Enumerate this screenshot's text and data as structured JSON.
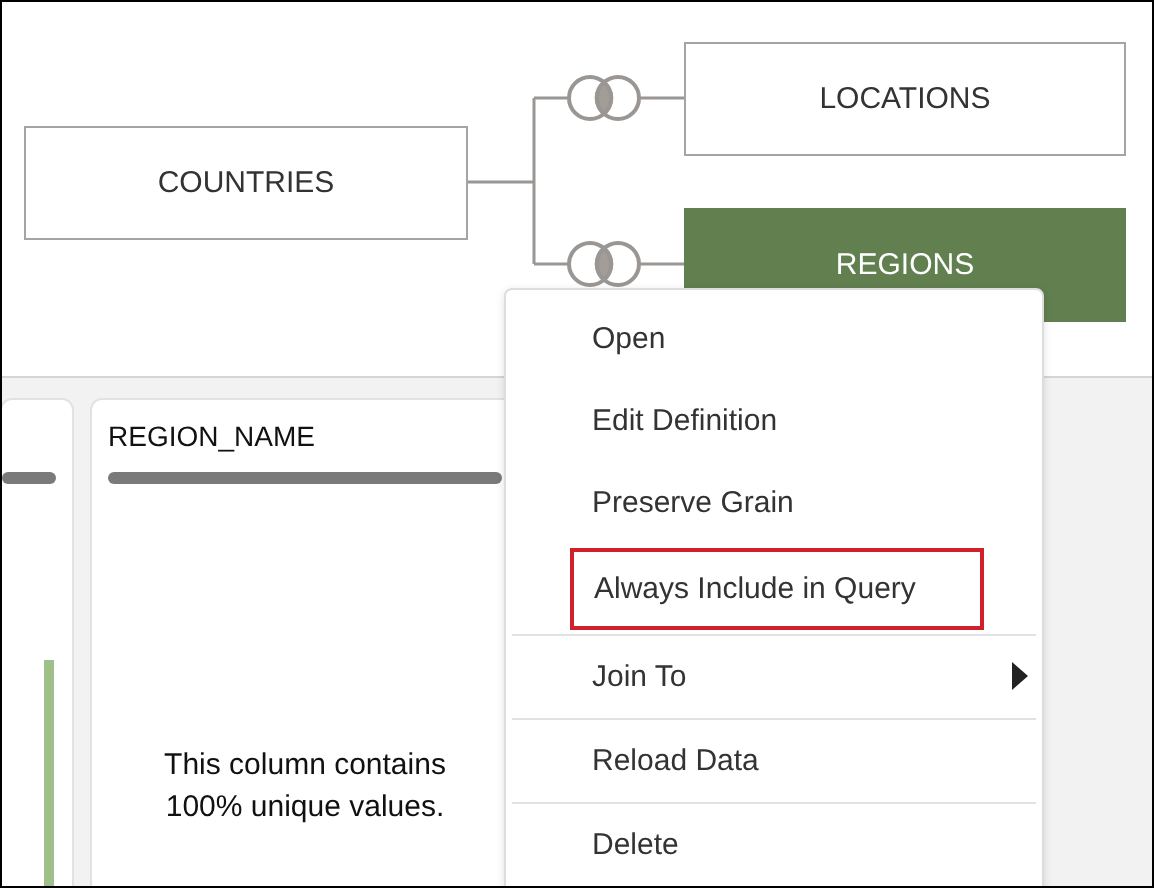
{
  "diagram": {
    "nodes": [
      {
        "label": "COUNTRIES",
        "selected": false
      },
      {
        "label": "LOCATIONS",
        "selected": false
      },
      {
        "label": "REGIONS",
        "selected": true
      }
    ]
  },
  "columns": [
    {},
    {
      "title": "REGION_NAME",
      "note": "This column contains 100% unique values."
    }
  ],
  "context_menu": {
    "items": [
      {
        "label": "Open",
        "highlighted": false,
        "submenu": false,
        "divider_before": false
      },
      {
        "label": "Edit Definition",
        "highlighted": false,
        "submenu": false,
        "divider_before": false
      },
      {
        "label": "Preserve Grain",
        "highlighted": false,
        "submenu": false,
        "divider_before": false
      },
      {
        "label": "Always Include in Query",
        "highlighted": true,
        "submenu": false,
        "divider_before": false
      },
      {
        "label": "Join To",
        "highlighted": false,
        "submenu": true,
        "divider_before": true
      },
      {
        "label": "Reload Data",
        "highlighted": false,
        "submenu": false,
        "divider_before": true
      },
      {
        "label": "Delete",
        "highlighted": false,
        "submenu": false,
        "divider_before": true
      }
    ]
  }
}
